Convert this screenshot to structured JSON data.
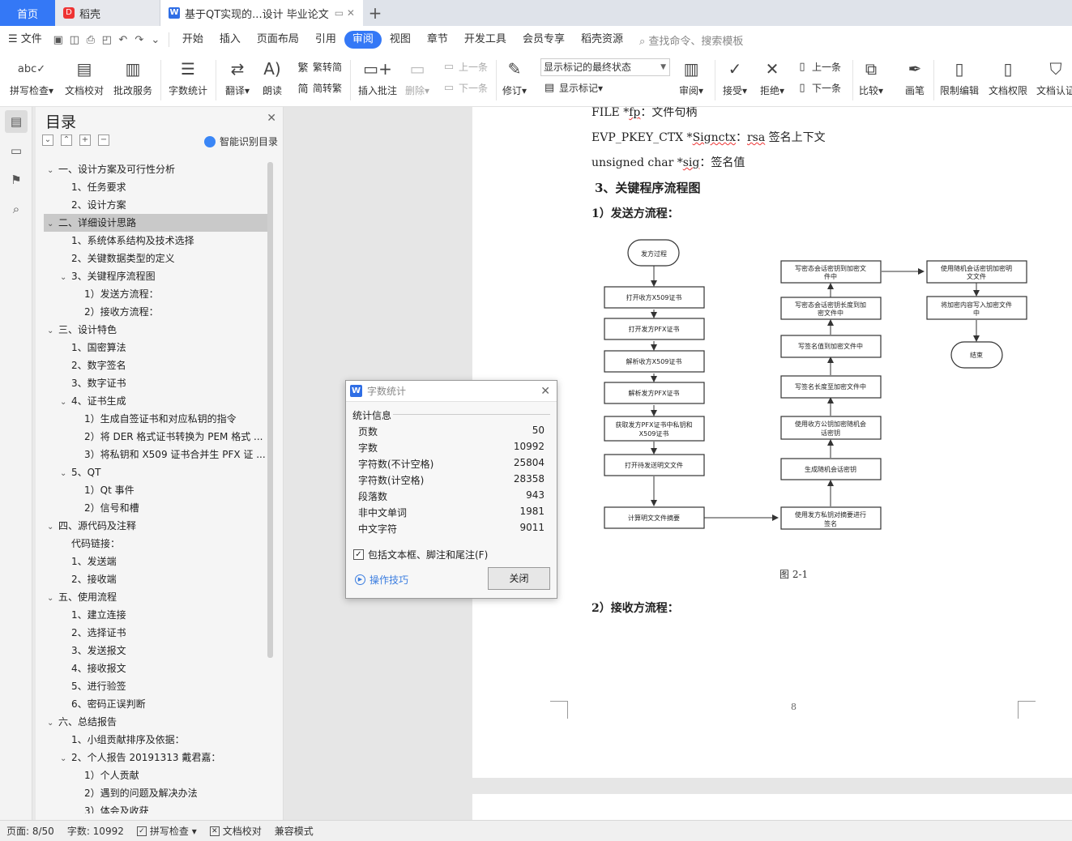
{
  "tabs": {
    "home": "首页",
    "daoke": "稻壳",
    "doc": "基于QT实现的...设计 毕业论文"
  },
  "menu": {
    "file": "文件",
    "items": [
      "开始",
      "插入",
      "页面布局",
      "引用",
      "审阅",
      "视图",
      "章节",
      "开发工具",
      "会员专享",
      "稻壳资源"
    ],
    "search_placeholder": "查找命令、搜索模板"
  },
  "ribbon": {
    "spell_check": "拼写检查",
    "doc_proof": "文档校对",
    "batch_service": "批改服务",
    "word_count": "字数统计",
    "translate": "翻译",
    "read_aloud": "朗读",
    "trad_to_simp": "繁转简",
    "simp_to_trad": "简转繁",
    "insert_comment": "插入批注",
    "delete": "删除",
    "prev_comment": "上一条",
    "next_comment": "下一条",
    "track_changes": "修订",
    "markup_select": "显示标记的最终状态",
    "show_markup": "显示标记",
    "review": "审阅",
    "accept": "接受",
    "reject": "拒绝",
    "prev_change": "上一条",
    "next_change": "下一条",
    "compare": "比较",
    "ink": "画笔",
    "restrict_edit": "限制编辑",
    "doc_permission": "文档权限",
    "doc_auth": "文档认证"
  },
  "toc": {
    "title": "目录",
    "smart_toc": "智能识别目录",
    "items": [
      {
        "text": "一、设计方案及可行性分析",
        "level": 1,
        "caret": "v"
      },
      {
        "text": "1、任务要求",
        "level": 2,
        "caret": ""
      },
      {
        "text": "2、设计方案",
        "level": 2,
        "caret": ""
      },
      {
        "text": "二、详细设计思路",
        "level": 1,
        "caret": "v"
      },
      {
        "text": "1、系统体系结构及技术选择",
        "level": 2,
        "caret": ""
      },
      {
        "text": "2、关键数据类型的定义",
        "level": 2,
        "caret": ""
      },
      {
        "text": "3、关键程序流程图",
        "level": 2,
        "caret": "v"
      },
      {
        "text": "1）发送方流程：",
        "level": 3,
        "caret": ""
      },
      {
        "text": "2）接收方流程：",
        "level": 3,
        "caret": ""
      },
      {
        "text": "三、设计特色",
        "level": 1,
        "caret": "v"
      },
      {
        "text": "1、国密算法",
        "level": 2,
        "caret": ""
      },
      {
        "text": "2、数字签名",
        "level": 2,
        "caret": ""
      },
      {
        "text": "3、数字证书",
        "level": 2,
        "caret": ""
      },
      {
        "text": "4、证书生成",
        "level": 2,
        "caret": "v"
      },
      {
        "text": "1）生成自签证书和对应私钥的指令",
        "level": 3,
        "caret": ""
      },
      {
        "text": "2）将 DER 格式证书转换为 PEM 格式 ...",
        "level": 3,
        "caret": ""
      },
      {
        "text": "3）将私钥和 X509 证书合并生 PFX 证 ...",
        "level": 3,
        "caret": ""
      },
      {
        "text": "5、QT",
        "level": 2,
        "caret": "v"
      },
      {
        "text": "1）Qt 事件",
        "level": 3,
        "caret": ""
      },
      {
        "text": "2）信号和槽",
        "level": 3,
        "caret": ""
      },
      {
        "text": "四、源代码及注释",
        "level": 1,
        "caret": "v"
      },
      {
        "text": "代码链接：",
        "level": 2,
        "caret": ""
      },
      {
        "text": "1、发送端",
        "level": 2,
        "caret": ""
      },
      {
        "text": "2、接收端",
        "level": 2,
        "caret": ""
      },
      {
        "text": "五、使用流程",
        "level": 1,
        "caret": "v"
      },
      {
        "text": "1、建立连接",
        "level": 2,
        "caret": ""
      },
      {
        "text": "2、选择证书",
        "level": 2,
        "caret": ""
      },
      {
        "text": "3、发送报文",
        "level": 2,
        "caret": ""
      },
      {
        "text": "4、接收报文",
        "level": 2,
        "caret": ""
      },
      {
        "text": "5、进行验签",
        "level": 2,
        "caret": ""
      },
      {
        "text": "6、密码正误判断",
        "level": 2,
        "caret": ""
      },
      {
        "text": "六、总结报告",
        "level": 1,
        "caret": "v"
      },
      {
        "text": "1、小组贡献排序及依据：",
        "level": 2,
        "caret": ""
      },
      {
        "text": "2、个人报告 20191313 戴君嘉：",
        "level": 2,
        "caret": "v"
      },
      {
        "text": "1）个人贡献",
        "level": 3,
        "caret": ""
      },
      {
        "text": "2）遇到的问题及解决办法",
        "level": 3,
        "caret": ""
      },
      {
        "text": "3）体会及收获",
        "level": 3,
        "caret": ""
      }
    ],
    "selected_index": 3
  },
  "document": {
    "line1_a": "FILE *",
    "line1_b": "fp",
    "line1_c": "：文件句柄",
    "line2_a": "EVP_PKEY_CTX *",
    "line2_b": "Signctx",
    "line2_c": "：",
    "line2_d": "rsa",
    "line2_e": " 签名上下文",
    "line3_a": "unsigned char *",
    "line3_b": "sig",
    "line3_c": "：签名值",
    "heading": "3、关键程序流程图",
    "sub1": "1）发送方流程：",
    "caption": "图 2-1",
    "sub2": "2）接收方流程：",
    "page_number": "8",
    "flowchart": {
      "start": "发方过程",
      "left_col": [
        "打开收方X509证书",
        "打开发方PFX证书",
        "解析收方X509证书",
        "解析发方PFX证书",
        "获取发方PFX证书中私钥和",
        "X509证书",
        "打开待发送明文文件",
        "计算明文文件摘要"
      ],
      "mid_col": [
        "写密态会话密钥到加密文",
        "件中",
        "写密态会话密钥长度到加",
        "密文件中",
        "写签名值到加密文件中",
        "写签名长度至加密文件中",
        "使用收方公钥加密随机会",
        "话密钥",
        "生成随机会话密钥",
        "使用发方私钥对摘要进行",
        "签名"
      ],
      "right_col": [
        "使用随机会话密钥加密明",
        "文文件",
        "将加密内容写入加密文件",
        "中"
      ],
      "end": "结束"
    }
  },
  "dialog": {
    "title": "字数统计",
    "section": "统计信息",
    "rows": [
      {
        "label": "页数",
        "value": "50"
      },
      {
        "label": "字数",
        "value": "10992"
      },
      {
        "label": "字符数(不计空格)",
        "value": "25804"
      },
      {
        "label": "字符数(计空格)",
        "value": "28358"
      },
      {
        "label": "段落数",
        "value": "943"
      },
      {
        "label": "非中文单词",
        "value": "1981"
      },
      {
        "label": "中文字符",
        "value": "9011"
      }
    ],
    "include_label": "包括文本框、脚注和尾注(F)",
    "tips": "操作技巧",
    "close": "关闭"
  },
  "status": {
    "page": "页面: 8/50",
    "words": "字数: 10992",
    "spell": "拼写检查",
    "proof": "文档校对",
    "compat": "兼容模式"
  }
}
